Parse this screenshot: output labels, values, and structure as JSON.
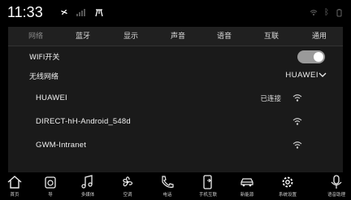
{
  "status_bar": {
    "time": "11:33",
    "icons": [
      "fan-icon",
      "signal-bars-icon",
      "antenna-icon",
      "wifi-status-icon",
      "bluetooth-status-icon",
      "battery-status-icon"
    ]
  },
  "tabs": [
    {
      "label": "网络",
      "selected": true
    },
    {
      "label": "蓝牙"
    },
    {
      "label": "显示"
    },
    {
      "label": "声音"
    },
    {
      "label": "语音"
    },
    {
      "label": "互联"
    },
    {
      "label": "通用"
    }
  ],
  "wifi": {
    "toggle_label": "WIFI开关",
    "enabled": true,
    "network_label": "无线网络",
    "network_selected": "HUAWEI",
    "networks": [
      {
        "name": "HUAWEI",
        "status": "已连接"
      },
      {
        "name": "DIRECT-hH-Android_548d",
        "status": ""
      },
      {
        "name": "GWM-Intranet",
        "status": ""
      }
    ]
  },
  "dock": [
    {
      "label": "首页",
      "icon": "home-icon"
    },
    {
      "label": "导",
      "icon": "navigation-icon"
    },
    {
      "label": "多媒体",
      "icon": "music-note-icon"
    },
    {
      "label": "空调",
      "icon": "fan-icon"
    },
    {
      "label": "电话",
      "icon": "phone-icon"
    },
    {
      "label": "手机互联",
      "icon": "phone-link-icon"
    },
    {
      "label": "新能源",
      "icon": "car-icon"
    },
    {
      "label": "系统设置",
      "icon": "gear-icon"
    },
    {
      "label": "语音助理",
      "icon": "microphone-icon"
    }
  ],
  "colors": {
    "background": "#000000",
    "panel": "#1a1a1a",
    "tab_bar": "#202020",
    "toggle_track": "#9a9a9a"
  }
}
